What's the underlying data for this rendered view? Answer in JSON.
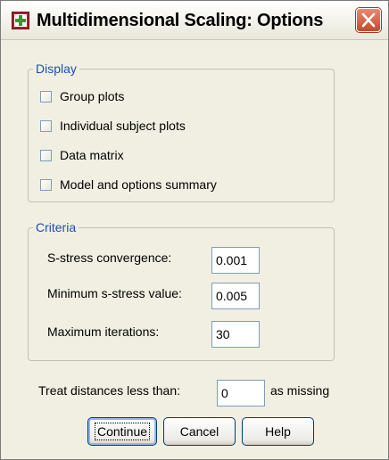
{
  "window": {
    "title": "Multidimensional Scaling: Options"
  },
  "display": {
    "label": "Display",
    "options": [
      {
        "label": "Group plots",
        "checked": false
      },
      {
        "label": "Individual subject plots",
        "checked": false
      },
      {
        "label": "Data matrix",
        "checked": false
      },
      {
        "label": "Model and options summary",
        "checked": false
      }
    ]
  },
  "criteria": {
    "label": "Criteria",
    "s_stress_convergence": {
      "label": "S-stress convergence:",
      "value": "0.001"
    },
    "minimum_s_stress": {
      "label": "Minimum s-stress value:",
      "value": "0.005"
    },
    "maximum_iterations": {
      "label": "Maximum iterations:",
      "value": "30"
    }
  },
  "missing": {
    "prefix": "Treat distances less than:",
    "value": "0",
    "suffix": "as missing"
  },
  "buttons": {
    "continue": "Continue",
    "cancel": "Cancel",
    "help": "Help"
  },
  "icons": {
    "app": "spss-dialog-icon",
    "close": "close-icon"
  },
  "colors": {
    "group_label": "#1a4fb5",
    "dialog_bg": "#f1efe2",
    "close_button": "#c9482a"
  }
}
